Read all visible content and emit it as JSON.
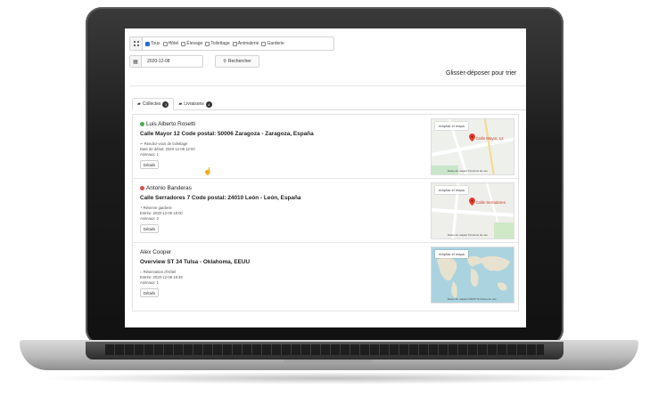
{
  "filters": [
    {
      "label": "Tous",
      "checked": true
    },
    {
      "label": "Hôtel",
      "checked": false
    },
    {
      "label": "Élevage",
      "checked": false
    },
    {
      "label": "Toilettage",
      "checked": false
    },
    {
      "label": "Animalerie",
      "checked": false
    },
    {
      "label": "Garderie",
      "checked": false
    }
  ],
  "date": {
    "value": "2020-12-08"
  },
  "search_label": "Rechercher",
  "drag_label": "Glisser-déposer pour trier",
  "tabs": [
    {
      "label": "Collectes",
      "count": "3"
    },
    {
      "label": "Livraisons",
      "count": "4"
    }
  ],
  "items": [
    {
      "name": "Luis Alberto Rosetti",
      "status_color": "#4cae4c",
      "address": "Calle Mayor 12 Code postal: 50006 Zaragoza - Zaragoza, España",
      "line1": "Rendez-vous de toilettage",
      "line2": "Date de début: 2020-12-08 12:00",
      "line3": "Animaux: 1",
      "details": "Détails",
      "map": {
        "button": "Ampliar el mapa",
        "label": "Calle Mayor, 12",
        "footer": "Datos de mapas    Términos de uso"
      }
    },
    {
      "name": "Antonio Banderas",
      "status_color": "#d9534f",
      "address": "Calle Serradores 7 Code postal: 24010 León - León, España",
      "line1": "Réserve garderie",
      "line2": "Entrée: 2020-12-08 18:00",
      "line3": "Animaux: 2",
      "details": "Détails",
      "map": {
        "button": "Ampliar el mapa",
        "label": "Calle Serradores",
        "footer": "Datos de mapas    Términos de uso"
      }
    },
    {
      "name": "Alex Cooper",
      "status_color": "",
      "address": "Overview ST 34 Tulsa - Oklahoma, EEUU",
      "line1": "Réservation d'Hôtel",
      "line2": "Entrée: 2020-12-08 18:49",
      "line3": "Animaux: 1",
      "details": "Détails",
      "map": {
        "button": "Ampliar el mapa",
        "label": "",
        "footer": "Datos de mapas ©2020    Términos de uso"
      }
    }
  ]
}
